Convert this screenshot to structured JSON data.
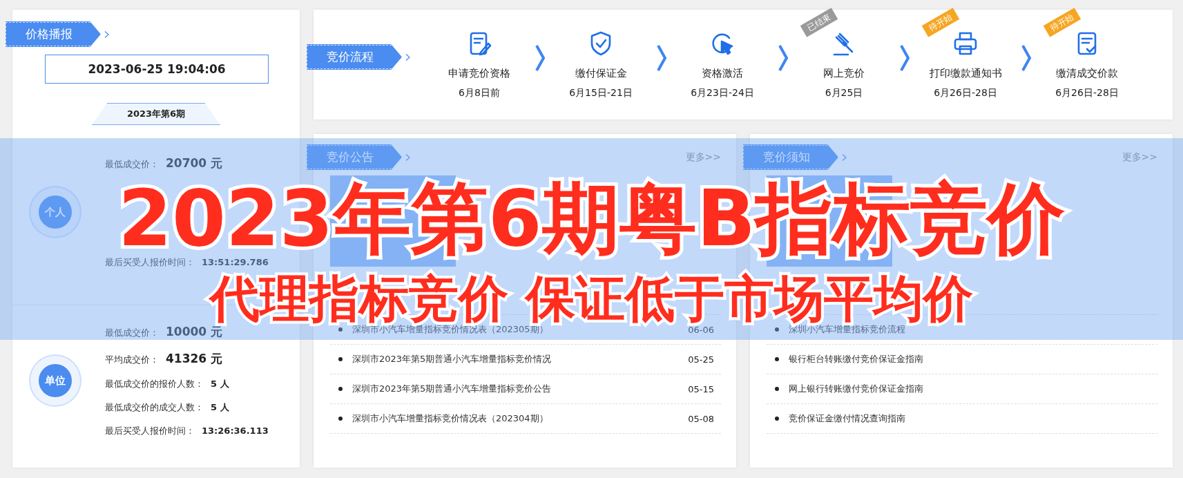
{
  "price_report": {
    "title": "价格播报",
    "datetime": "2023-06-25 19:04:06",
    "period": "2023年第6期",
    "groups": [
      {
        "label": "个人",
        "rows": [
          {
            "label": "最低成交价：",
            "value": "20700 元",
            "kind": "price"
          },
          {
            "label": "最后买受人报价时间：",
            "value": "13:51:29.786",
            "kind": "info"
          }
        ]
      },
      {
        "label": "单位",
        "rows": [
          {
            "label": "最低成交价：",
            "value": "10000 元",
            "kind": "price"
          },
          {
            "label": "平均成交价：",
            "value": "41326 元",
            "kind": "price"
          },
          {
            "label": "最低成交价的报价人数：",
            "value": "5 人",
            "kind": "info"
          },
          {
            "label": "最低成交价的成交人数：",
            "value": "5 人",
            "kind": "info"
          },
          {
            "label": "最后买受人报价时间：",
            "value": "13:26:36.113",
            "kind": "info"
          }
        ]
      }
    ]
  },
  "process": {
    "title": "竞价流程",
    "steps": [
      {
        "name": "申请竞价资格",
        "date": "6月8日前"
      },
      {
        "name": "缴付保证金",
        "date": "6月15日-21日"
      },
      {
        "name": "资格激活",
        "date": "6月23日-24日"
      },
      {
        "name": "网上竞价",
        "date": "6月25日",
        "badge": {
          "text": "已结束",
          "kind": "ended"
        }
      },
      {
        "name": "打印缴款通知书",
        "date": "6月26日-28日",
        "badge": {
          "text": "待开始",
          "kind": "pending"
        }
      },
      {
        "name": "缴清成交价款",
        "date": "6月26日-28日",
        "badge": {
          "text": "待开始",
          "kind": "pending"
        }
      }
    ]
  },
  "announcements": {
    "title": "竞价公告",
    "more": "更多>>",
    "items": [
      {
        "title": "深圳市小汽车增量指标竞价情况表（202305期）",
        "date": "06-06"
      },
      {
        "title": "深圳市2023年第5期普通小汽车增量指标竞价情况",
        "date": "05-25"
      },
      {
        "title": "深圳市2023年第5期普通小汽车增量指标竞价公告",
        "date": "05-15"
      },
      {
        "title": "深圳市小汽车增量指标竞价情况表（202304期）",
        "date": "05-08"
      }
    ]
  },
  "notices": {
    "title": "竞价须知",
    "more": "更多>>",
    "items": [
      {
        "title": "深圳小汽车增量指标竞价流程"
      },
      {
        "title": "银行柜台转账缴付竞价保证金指南"
      },
      {
        "title": "网上银行转账缴付竞价保证金指南"
      },
      {
        "title": "竞价保证金缴付情况查询指南"
      }
    ]
  },
  "promo_banner": {
    "headline": "2023年第6期粤B指标竞价",
    "subline": "代理指标竞价 保证低于市场平均价"
  }
}
